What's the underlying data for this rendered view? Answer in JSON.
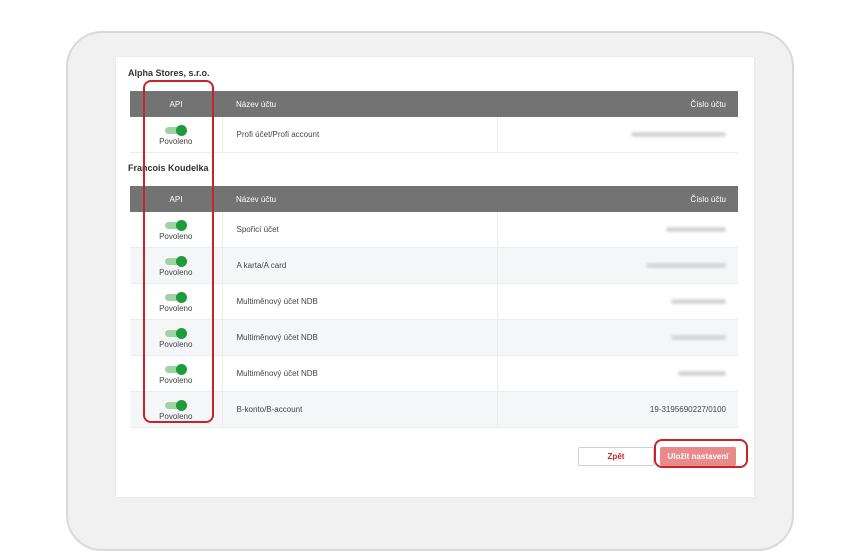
{
  "colors": {
    "table_header_bg": "#737373",
    "toggle_on_knob": "#1e9b3a",
    "toggle_on_track": "#9ed3a4",
    "highlight": "#c6242a",
    "save_button_bg": "#e88a8a",
    "back_button_text": "#c62828"
  },
  "columns": {
    "api": "API",
    "name": "Název účtu",
    "number": "Číslo účtu"
  },
  "groups": [
    {
      "company": "Alpha Stores, s.r.o.",
      "rows": [
        {
          "api_status": "Povoleno",
          "api_enabled": true,
          "name": "Profi účet/Profi account",
          "number": "",
          "number_hidden": true
        }
      ]
    },
    {
      "company": "Francois Koudelka",
      "rows": [
        {
          "api_status": "Povoleno",
          "api_enabled": true,
          "name": "Spořicí účet",
          "number": "",
          "number_hidden": true
        },
        {
          "api_status": "Povoleno",
          "api_enabled": true,
          "name": "A karta/A card",
          "number": "",
          "number_hidden": true
        },
        {
          "api_status": "Povoleno",
          "api_enabled": true,
          "name": "Multiměnový účet NDB",
          "number": "",
          "number_hidden": true
        },
        {
          "api_status": "Povoleno",
          "api_enabled": true,
          "name": "Multiměnový účet NDB",
          "number": "",
          "number_hidden": true
        },
        {
          "api_status": "Povoleno",
          "api_enabled": true,
          "name": "Multiměnový účet NDB",
          "number": "",
          "number_hidden": true
        },
        {
          "api_status": "Povoleno",
          "api_enabled": true,
          "name": "B-konto/B-account",
          "number": "19-3195690227/0100",
          "number_hidden": false
        }
      ]
    }
  ],
  "buttons": {
    "back": "Zpět",
    "save": "Uložit nastavení"
  }
}
